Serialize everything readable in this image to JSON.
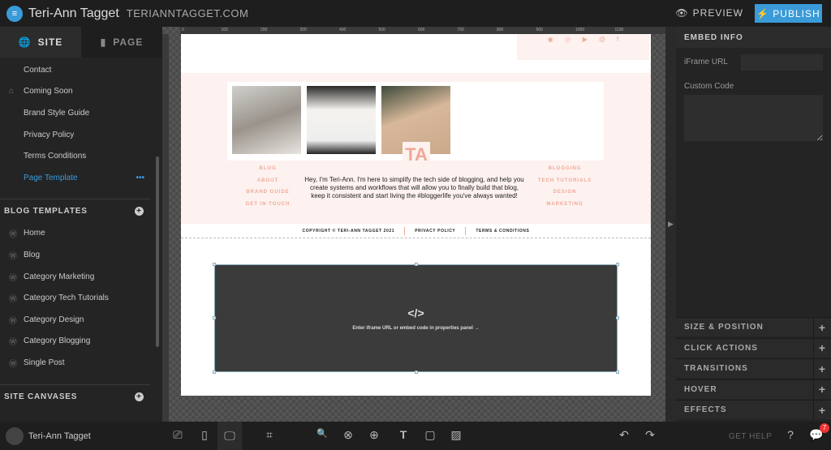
{
  "header": {
    "site_name": "Teri-Ann Tagget",
    "domain": "TERIANNTAGGET.COM",
    "preview_label": "PREVIEW",
    "publish_label": "PUBLISH"
  },
  "sidebar": {
    "tabs": [
      {
        "label": "SITE",
        "icon": "globe-icon"
      },
      {
        "label": "PAGE",
        "icon": "page-icon"
      }
    ],
    "pages": [
      {
        "label": "Contact"
      },
      {
        "label": "Coming Soon",
        "icon": "home-icon"
      },
      {
        "label": "Brand Style Guide"
      },
      {
        "label": "Privacy Policy"
      },
      {
        "label": "Terms Conditions"
      },
      {
        "label": "Page Template",
        "active": true
      }
    ],
    "more_label": "•••",
    "blog_templates_title": "BLOG TEMPLATES",
    "blog_templates": [
      {
        "label": "Home"
      },
      {
        "label": "Blog"
      },
      {
        "label": "Category Marketing"
      },
      {
        "label": "Category Tech Tutorials"
      },
      {
        "label": "Category Design"
      },
      {
        "label": "Category Blogging"
      },
      {
        "label": "Single Post"
      }
    ],
    "site_canvases_title": "SITE CANVASES"
  },
  "canvas": {
    "ruler": [
      "0",
      "100",
      "200",
      "300",
      "400",
      "500",
      "600",
      "700",
      "800",
      "900",
      "1000",
      "1100"
    ],
    "monogram": "TA",
    "left_nav": [
      "BLOG",
      "ABOUT",
      "BRAND GUIDE",
      "GET IN TOUCH"
    ],
    "right_nav": [
      "BLOGGING",
      "TECH TUTORIALS",
      "DESIGN",
      "MARKETING"
    ],
    "bio": "Hey, I'm Teri-Ann. I'm here to simplify the tech side of blogging, and help you create systems and workflows that will allow you to finally build that blog, keep it consistent and start living the #bloggerlife you've always wanted!",
    "copyright": "COPYRIGHT © TERI-ANN TAGGET 2021",
    "privacy": "PRIVACY POLICY",
    "terms": "TERMS & CONDITIONS",
    "embed_icon": "</>",
    "embed_message": "Enter iframe URL or embed code in properties panel →",
    "accent": "#f0a898"
  },
  "panel": {
    "title": "EMBED INFO",
    "iframe_label": "iFrame URL",
    "iframe_value": "",
    "custom_code_label": "Custom Code",
    "custom_code_value": "",
    "sections": [
      "SIZE & POSITION",
      "CLICK ACTIONS",
      "TRANSITIONS",
      "HOVER",
      "EFFECTS"
    ]
  },
  "bottom": {
    "user": "Teri-Ann Tagget",
    "get_help": "GET HELP",
    "notifications": "7"
  },
  "colors": {
    "brand": "#3a9bd9",
    "blush": "#fdf2ef"
  }
}
